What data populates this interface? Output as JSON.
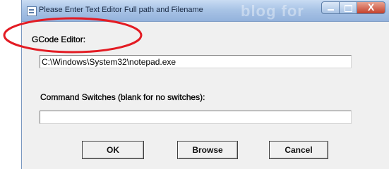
{
  "window": {
    "title": "Please Enter Text Editor Full path and Filename",
    "watermark": "blog for",
    "controls": {
      "close_label": "X"
    }
  },
  "form": {
    "gcode_label": "GCode Editor:",
    "gcode_value": "C:\\Windows\\System32\\notepad.exe",
    "switches_label": "Command Switches (blank for no switches):",
    "switches_value": ""
  },
  "buttons": {
    "ok": "OK",
    "browse": "Browse",
    "cancel": "Cancel"
  },
  "annotation": {
    "color": "#e31b23"
  }
}
